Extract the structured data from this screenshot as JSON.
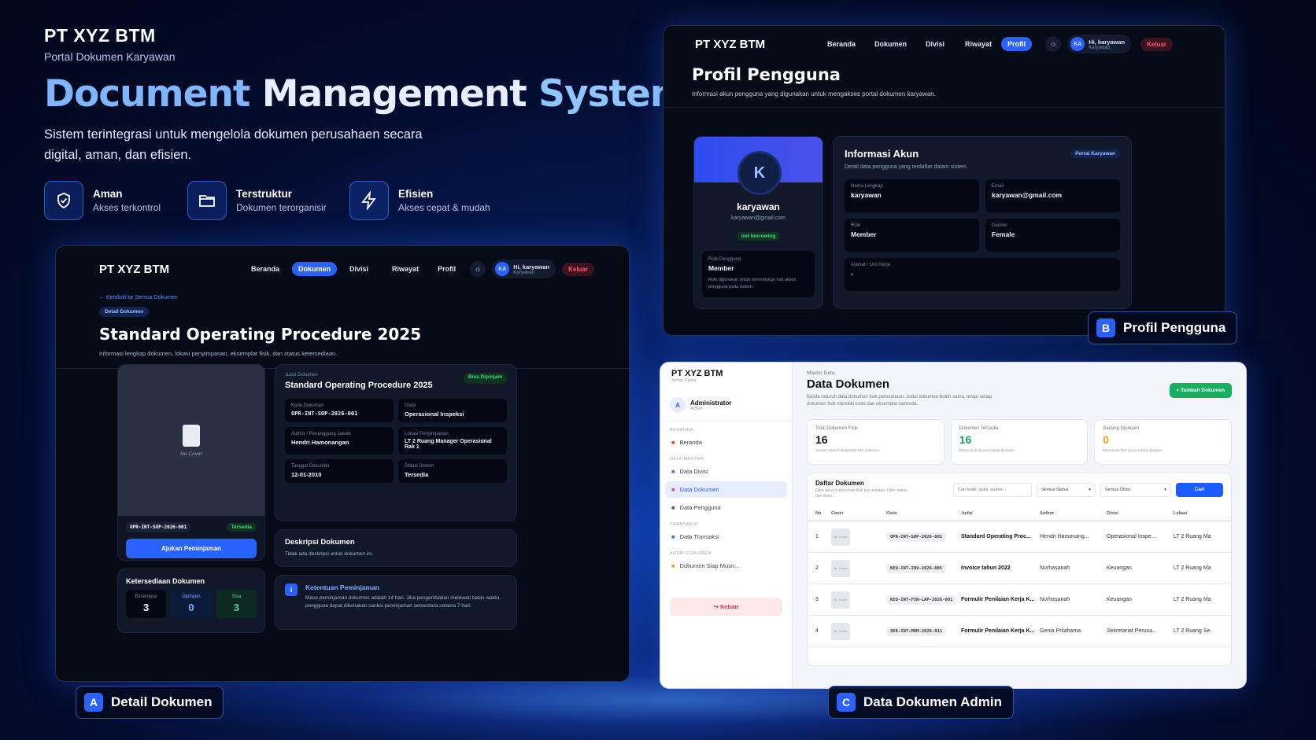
{
  "hero": {
    "brand": "PT XYZ BTM",
    "brand_sub": "Portal Dokumen Karyawan",
    "title_1": "Document",
    "title_2": "Management",
    "title_3": "System",
    "description": "Sistem terintegrasi untuk mengelola dokumen perusahaen secara digital, aman, dan efisien.",
    "features": [
      {
        "icon": "shield-icon",
        "title": "Aman",
        "subtitle": "Akses terkontrol"
      },
      {
        "icon": "folder-icon",
        "title": "Terstruktur",
        "subtitle": "Dokumen terorganisir"
      },
      {
        "icon": "lightning-icon",
        "title": "Efisien",
        "subtitle": "Akses cepat & mudah"
      }
    ]
  },
  "screen_a": {
    "logo": "PT XYZ BTM",
    "nav": [
      "Beranda",
      "Dokumen",
      "Divisi",
      "Riwayat",
      "Profil"
    ],
    "nav_active": 1,
    "user_name": "Hi, karyawan",
    "user_role": "Karyawan",
    "avatar": "KA",
    "logout": "Keluar",
    "back_link": "← Kembali ke Semua Dokumen",
    "badge": "Detail Dokumen",
    "title": "Standard Operating Procedure 2025",
    "subtitle": "Informasi lengkap dokumen, lokasi penyimpanan, eksemplar fisik, dan status ketersediaan.",
    "cover_text": "No Cover",
    "code": "OPR-INT-SOP-2026-001",
    "status_pill": "Tersedia",
    "borrow_button": "Ajukan Peminjaman",
    "availability_title": "Ketersediaan Dokumen",
    "availability": [
      {
        "label": "Eksemplar",
        "value": "3"
      },
      {
        "label": "Dipinjam",
        "value": "0"
      },
      {
        "label": "Sisa",
        "value": "3"
      }
    ],
    "judul_label": "Judul Dokumen",
    "judul_value": "Standard Operating Procedure 2025",
    "borrowable": "Bisa Dipinjam",
    "fields": [
      {
        "label": "Kode Dokumen",
        "value": "OPR-INT-SOP-2026-001"
      },
      {
        "label": "Divisi",
        "value": "Operasional Inspeksi"
      },
      {
        "label": "Author / Penanggung Jawab",
        "value": "Hendri Hamonangan"
      },
      {
        "label": "Lokasi Penyimpanan",
        "value": "LT 2 Ruang Manager Operasional Rak 1"
      },
      {
        "label": "Tanggal Dokumen",
        "value": "12-01-2010"
      },
      {
        "label": "Status Sistem",
        "value": "Tersedia"
      }
    ],
    "desc_title": "Deskripsi Dokumen",
    "desc_text": "Tidak ada deskripsi untuk dokumen ini.",
    "rule_title": "Ketentuan Peminjaman",
    "rule_text": "Masa peminjaman dokumen adalah 14 hari. Jika pengembalian melewati batas waktu, pengguna dapat dikenakan sanksi peminjaman sementara selama 7 hari.",
    "label_letter": "A",
    "label_text": "Detail Dokumen"
  },
  "screen_b": {
    "logo": "PT XYZ BTM",
    "nav": [
      "Beranda",
      "Dokumen",
      "Divisi",
      "Riwayat",
      "Profil"
    ],
    "nav_active": 4,
    "user_name": "Hi, karyawan",
    "user_role": "Karyawan",
    "avatar": "KA",
    "logout": "Keluar",
    "title": "Profil Pengguna",
    "subtitle": "Informasi akun pengguna yang digunakan untuk mengakses portal dokumen karyawan.",
    "profile_initial": "K",
    "profile_name": "karyawan",
    "profile_email": "karyawan@gmail.com",
    "profile_status": "not borrowing",
    "role_label": "Role Pengguna",
    "role_value": "Member",
    "role_desc": "Role digunakan untuk menentukan hak akses pengguna pada sistem.",
    "info_title": "Informasi Akun",
    "info_pill": "Portal Karyawan",
    "info_sub": "Detail data pengguna yang terdaftar dalam sistem.",
    "fields": [
      {
        "label": "Nama Lengkap",
        "value": "karyawan"
      },
      {
        "label": "Email",
        "value": "karyawan@gmail.com"
      },
      {
        "label": "Role",
        "value": "Member"
      },
      {
        "label": "Gender",
        "value": "Female"
      }
    ],
    "address_label": "Alamat / Unit Kerja",
    "address_value": "-",
    "label_letter": "B",
    "label_text": "Profil Pengguna"
  },
  "screen_c": {
    "logo": "PT XYZ BTM",
    "logo_sub": "Admin Panel",
    "admin_initial": "A",
    "admin_name": "Administrator",
    "admin_role": "Admin",
    "sidebar": [
      {
        "section": "BERANDA",
        "items": [
          {
            "label": "Beranda",
            "icon": "home-icon"
          }
        ]
      },
      {
        "section": "DATA MASTER",
        "items": [
          {
            "label": "Data Divisi",
            "icon": "building-icon"
          },
          {
            "label": "Data Dokumen",
            "icon": "document-icon"
          },
          {
            "label": "Data Pengguna",
            "icon": "users-icon"
          }
        ]
      },
      {
        "section": "TRANSAKSI",
        "items": [
          {
            "label": "Data Transaksi",
            "icon": "transaction-icon"
          }
        ]
      },
      {
        "section": "ARSIP DOKUMEN",
        "items": [
          {
            "label": "Dokumen Siap Musn...",
            "icon": "archive-icon"
          }
        ]
      }
    ],
    "active_item": "Data Dokumen",
    "logout": "Keluar",
    "crumb": "Master Data",
    "title": "Data Dokumen",
    "subtitle": "Kelola seluruh data dokumen fisik perusahaan. Judul dokumen boleh sama, tetapi setiap dokumen fisik memiliki kode dan eksemplar berbeda.",
    "add_button": "+ Tambah Dokumen",
    "stats": [
      {
        "label": "Total Dokumen Fisik",
        "value": "16",
        "sub": "Jumlah seluruh eksemplar fisik dokumen",
        "color": "#111111"
      },
      {
        "label": "Dokumen Tersedia",
        "value": "16",
        "sub": "Dokumen fisik yang dapat dipinjam",
        "color": "#18a058"
      },
      {
        "label": "Sedang Dipinjam",
        "value": "0",
        "sub": "Eksemplar fisik yang sedang dipinjam",
        "color": "#f0a020"
      }
    ],
    "list_title": "Daftar Dokumen",
    "list_sub": "Data seluruh dokumen fisik perusahaan. Filter status dan divisi.",
    "search_placeholder": "Cari kode, judul, author...",
    "status_filter": "Semua Status",
    "division_filter": "Semua Divisi",
    "search_button": "Cari",
    "columns": [
      "No",
      "Cover",
      "Kode",
      "Judul",
      "Author",
      "Divisi",
      "Lokasi"
    ],
    "rows": [
      {
        "no": "1",
        "cover": "No Cover",
        "code": "OPR-INT-SOP-2026-001",
        "title": "Standard Operating Proc...",
        "author": "Hendri Hamonang...",
        "division": "Operasional Inspe...",
        "location": "LT 2 Ruang Ma"
      },
      {
        "no": "2",
        "cover": "No Cover",
        "code": "KEU-INT-INV-2026-005",
        "title": "Invoice tahun 2022",
        "author": "Nurhasanah",
        "division": "Keuangan",
        "location": "LT 2 Ruang Ma"
      },
      {
        "no": "3",
        "cover": "No Cover",
        "code": "KEU-INT-FIN-LAP-2026-001",
        "title": "Formulir Penilaian Kerja K...",
        "author": "Nurhasanah",
        "division": "Keuangan",
        "location": "LT 2 Ruang Ma"
      },
      {
        "no": "4",
        "cover": "No Cover",
        "code": "SEK-INT-MOM-2026-011",
        "title": "Formulir Penilaian Kerja K...",
        "author": "Genia Prilahama",
        "division": "Sekretariat Perusa...",
        "location": "LT 2 Ruang Se"
      }
    ],
    "label_letter": "C",
    "label_text": "Data Dokumen Admin"
  }
}
